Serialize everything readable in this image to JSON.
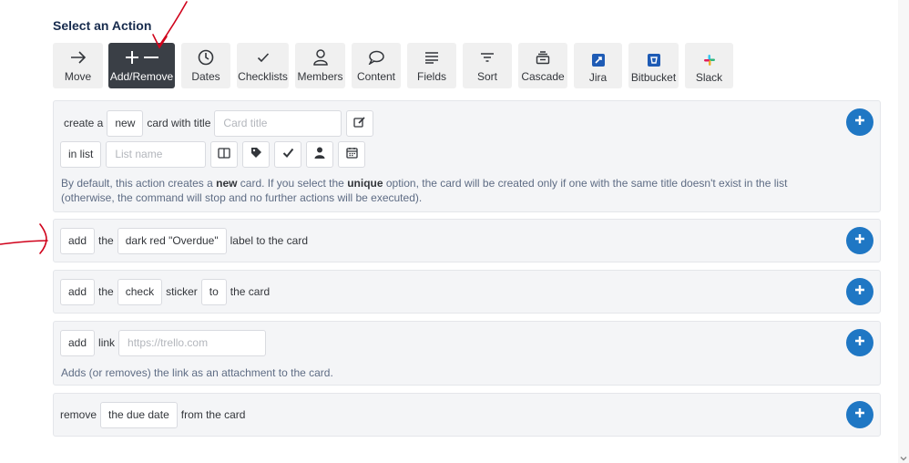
{
  "heading": "Select an Action",
  "toolbar": [
    {
      "label": "Move",
      "icon": "arrow-right-icon"
    },
    {
      "label": "Add/Remove",
      "icon": "plus-minus-icon",
      "active": true
    },
    {
      "label": "Dates",
      "icon": "clock-icon"
    },
    {
      "label": "Checklists",
      "icon": "check-icon"
    },
    {
      "label": "Members",
      "icon": "person-icon"
    },
    {
      "label": "Content",
      "icon": "speech-bubble-icon"
    },
    {
      "label": "Fields",
      "icon": "lines-icon"
    },
    {
      "label": "Sort",
      "icon": "sort-icon"
    },
    {
      "label": "Cascade",
      "icon": "cascade-icon"
    },
    {
      "label": "Jira",
      "icon": "jira-icon"
    },
    {
      "label": "Bitbucket",
      "icon": "bitbucket-icon"
    },
    {
      "label": "Slack",
      "icon": "slack-icon"
    }
  ],
  "create_card": {
    "create_a": "create a",
    "new_chip": "new",
    "card_with_title": "card with title",
    "title_placeholder": "Card title",
    "in_list_chip": "in list",
    "list_placeholder": "List name",
    "note_1": "By default, this action creates a",
    "note_new": "new",
    "note_2": "card. If you select the",
    "note_unique": "unique",
    "note_3": "option, the card will be created only if one with the same title doesn't exist in the list",
    "note_line2": "(otherwise, the command will stop and no further actions will be executed)."
  },
  "add_label": {
    "verb": "add",
    "the": "the",
    "label_value": "dark red \"Overdue\"",
    "suffix": "label to the card"
  },
  "add_sticker": {
    "verb": "add",
    "the": "the",
    "sticker_value": "check",
    "sticker": "sticker",
    "to": "to",
    "suffix": "the card"
  },
  "add_link": {
    "verb": "add",
    "link": "link",
    "link_placeholder": "https://trello.com",
    "note": "Adds (or removes) the link as an attachment to the card."
  },
  "remove_due": {
    "verb": "remove",
    "value": "the due date",
    "suffix": "from the card"
  },
  "colors": {
    "accent_blue": "#1f77c4",
    "active_tool": "#3a3f46",
    "annotation_red": "#d0021b"
  }
}
